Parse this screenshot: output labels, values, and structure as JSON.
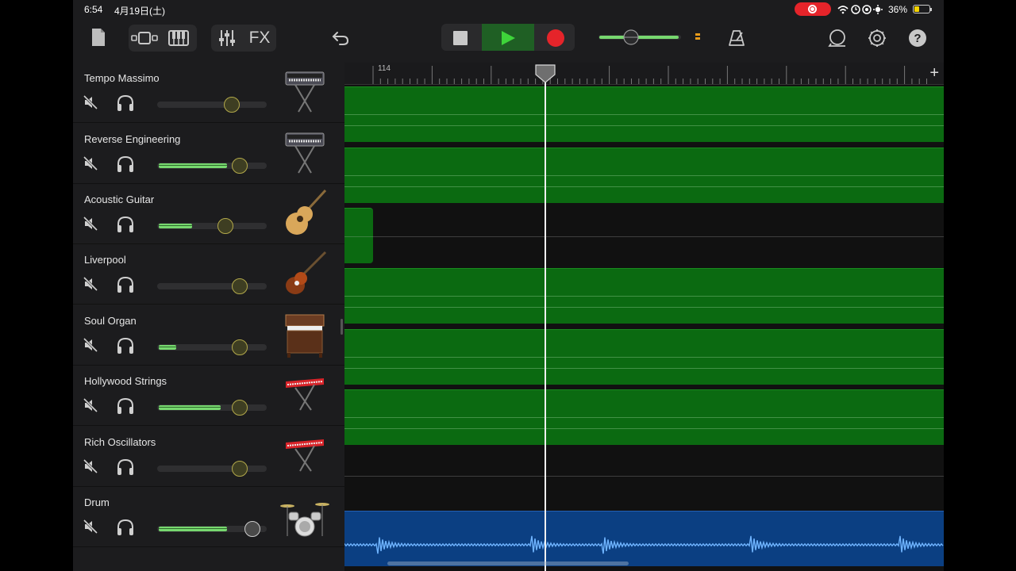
{
  "status_bar": {
    "time": "6:54",
    "date": "4月19日(土)",
    "battery_pct": "36%",
    "battery_level": 0.36
  },
  "toolbar": {
    "fx_label": "FX"
  },
  "colors": {
    "region_green": "#0b6a11",
    "region_blue": "#0b3f82",
    "record": "#e5242a",
    "play": "#3ed43a",
    "volume": "#77d86f"
  },
  "master_volume": 0.4,
  "ruler": {
    "bar_label": "114"
  },
  "tracks": [
    {
      "name": "Tempo Massimo",
      "instrument": "synth-keyboard-icon",
      "volume": 0.68,
      "region": "green"
    },
    {
      "name": "Reverse Engineering",
      "instrument": "synth-keyboard-icon",
      "volume": 0.75,
      "region": "green"
    },
    {
      "name": "Acoustic Guitar",
      "instrument": "acoustic-guitar-icon",
      "volume": 0.62,
      "region": "green-short"
    },
    {
      "name": "Liverpool",
      "instrument": "bass-guitar-icon",
      "volume": 0.75,
      "region": "green"
    },
    {
      "name": "Soul Organ",
      "instrument": "organ-icon",
      "volume": 0.75,
      "region": "green"
    },
    {
      "name": "Hollywood Strings",
      "instrument": "red-keyboard-icon",
      "volume": 0.75,
      "region": "green"
    },
    {
      "name": "Rich Oscillators",
      "instrument": "red-keyboard-icon",
      "volume": 0.75,
      "region": "none"
    },
    {
      "name": "Drum",
      "instrument": "drum-kit-icon",
      "volume": 0.87,
      "region": "blue"
    }
  ]
}
